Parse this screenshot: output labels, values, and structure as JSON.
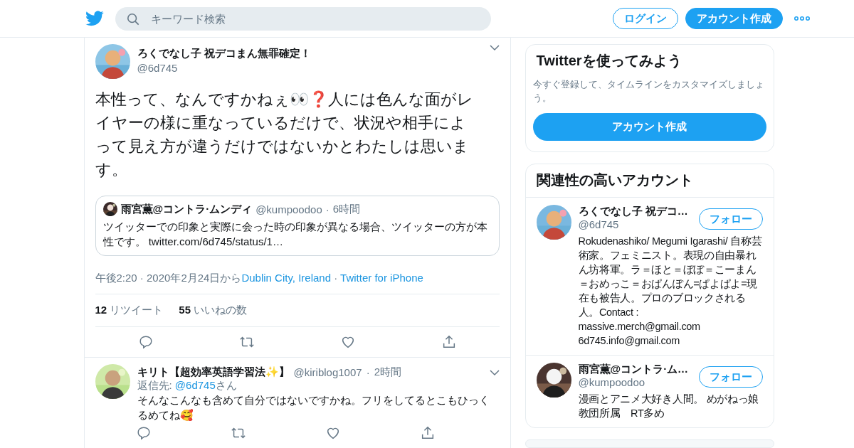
{
  "header": {
    "search": {
      "placeholder": "キーワード検索"
    },
    "login": "ログイン",
    "signup": "アカウント作成"
  },
  "tweet": {
    "name": "ろくでなし子 祝デコまん無罪確定！",
    "handle": "@6d745",
    "text": "本性って、なんですかねぇ👀❓人には色んな面がレイヤーの様に重なっているだけで、状況や相手によって見え方が違うだけではないかとわたしは思います。",
    "quote": {
      "name": "雨宮薫@コントラ·ムンディ",
      "handle": "@kumpoodoo",
      "separator": "·",
      "time": "6時間",
      "text": "ツイッターでの印象と実際に会った時の印象が異なる場合、ツイッターの方が本性です。",
      "link": "twitter.com/6d745/status/1…"
    },
    "meta": {
      "time": "午後2:20 · 2020年2月24日から",
      "place": "Dublin City, Ireland",
      "separator": "·",
      "source": "Twitter for iPhone"
    },
    "stats": [
      {
        "count": "12",
        "label": "リツイート"
      },
      {
        "count": "55",
        "label": "いいねの数"
      }
    ]
  },
  "replies": [
    {
      "name": "キリト【超効率英語学習法✨】",
      "handle": "@kiriblog1007",
      "separator": "·",
      "time": "2時間",
      "reply_prefix": "返信先: ",
      "reply_to": "@6d745",
      "reply_suffix": "さん",
      "text": "そんなこんなも含めて自分ではないですかね。フリをしてるとこもひっくるめてね🥰"
    }
  ],
  "signup_card": {
    "title": "Twitterを使ってみよう",
    "text": "今すぐ登録して、タイムラインをカスタマイズしましょう。",
    "button": "アカウント作成"
  },
  "related": {
    "title": "関連性の高いアカウント",
    "accounts": [
      {
        "name": "ろくでなし子 祝デコ…",
        "handle": "@6d745",
        "follow": "フォロー",
        "bio": "Rokudenashiko/ Megumi Igarashi/ 自称芸術家。フェミニスト。表現の自由暴れん坊将軍。ラ＝ほと＝ぼぼ＝こーまん＝おめっこ＝おぱんぽん=ぱよぱよ=現在も被告人。プロのブロックされる人。Contact :\nmassive.merch@gmail.com\n6d745.info@gmail.com"
      },
      {
        "name": "雨宮薫@コントラ·ム…",
        "handle": "@kumpoodoo",
        "follow": "フォロー",
        "bio": "漫画とアニメ大好き人間。 めがねっ娘教団所属　RT多め"
      }
    ]
  }
}
